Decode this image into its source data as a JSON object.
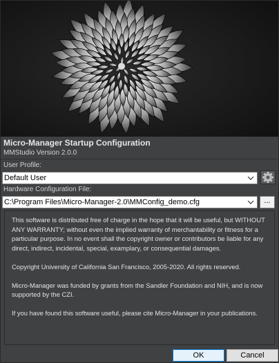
{
  "window": {
    "title": "Micro-Manager Startup Configuration",
    "version": "MMStudio Version 2.0.0"
  },
  "profile": {
    "label": "User Profile:",
    "selected": "Default User",
    "settings_icon": "gear-icon"
  },
  "hardware_config": {
    "label": "Hardware Configuration File:",
    "selected": "C:\\Program Files\\Micro-Manager-2.0\\MMConfig_demo.cfg",
    "browse_label": "..."
  },
  "license": {
    "p1": "This software is distributed free of charge in the hope that it will be useful, but WITHOUT ANY WARRANTY; without even the implied warranty of merchantability or fitness for a particular purpose. In no event shall the copyright owner or contributors be liable for any direct, indirect, incidental, special, examplary, or consequential damages.",
    "p2": "Copyright University of California San Francisco, 2005-2020. All rights reserved.",
    "p3": "Micro-Manager was funded by grants from the Sandler Foundation and NIH, and is now supported by the CZI.",
    "p4": "If you have found this software useful, please cite Micro-Manager in your publications."
  },
  "buttons": {
    "ok": "OK",
    "cancel": "Cancel"
  },
  "colors": {
    "background": "#3f4143",
    "text": "#e4e4e4",
    "ok_border": "#0078d7"
  }
}
